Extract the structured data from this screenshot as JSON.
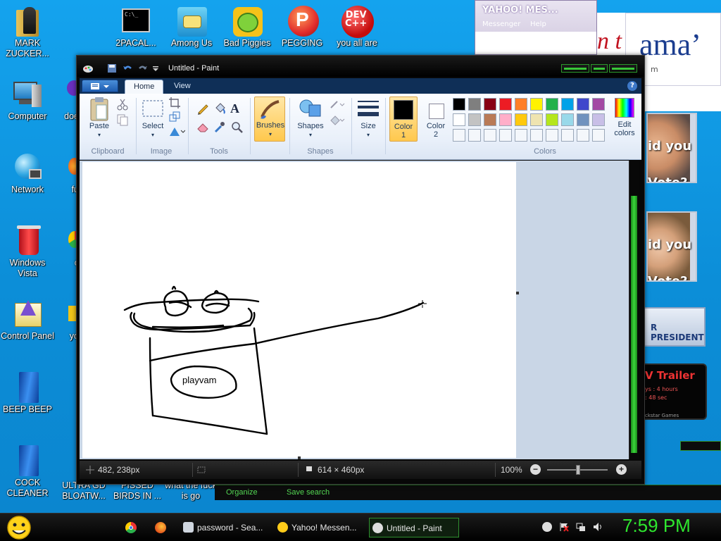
{
  "desktop": {
    "icons_col1": [
      {
        "label": "MARK ZUCKER..."
      },
      {
        "label": "Computer"
      },
      {
        "label": "Network"
      },
      {
        "label": "Windows Vista"
      },
      {
        "label": "Control Panel"
      },
      {
        "label": "BEEP BEEP"
      },
      {
        "label": "COCK CLEANER"
      }
    ],
    "icons_col2": [
      {
        "label": "doe"
      },
      {
        "label": "fu"
      },
      {
        "label": "c"
      },
      {
        "label": "yo"
      }
    ],
    "icons_top": [
      {
        "label": "2PACAL..."
      },
      {
        "label": "Among Us"
      },
      {
        "label": "Bad Piggies"
      },
      {
        "label": "PEGGING"
      },
      {
        "label": "you all are"
      }
    ],
    "icons_bottom": [
      {
        "label": "ULTRA GD BLOATW..."
      },
      {
        "label": "PISSED BIRDS IN ..."
      },
      {
        "label": "what the fuck is go"
      }
    ],
    "yahoo_window": {
      "title": "YAHOO! MES...",
      "menu": [
        "Messenger",
        "Help"
      ]
    },
    "bg_page": {
      "banner_text": "n t",
      "logo_text": "ama’",
      "logo_sub": "m",
      "ad1": "id you\nVote?",
      "ad2": "id you\nVote?",
      "president_btn": "R PRESIDENT",
      "trailer": {
        "title": "V Trailer",
        "l1": "ys : 4 hours",
        "l2": ": 48 sec",
        "brand": "ckstar Games"
      }
    }
  },
  "paint": {
    "title": "Untitled - Paint",
    "tabs": [
      "Home",
      "View"
    ],
    "active_tab": "Home",
    "groups": {
      "clipboard": {
        "name": "Clipboard",
        "paste": "Paste"
      },
      "image": {
        "name": "Image",
        "select": "Select"
      },
      "tools": {
        "name": "Tools"
      },
      "brushes": {
        "label": "Brushes"
      },
      "shapes": {
        "name": "Shapes",
        "label": "Shapes"
      },
      "size": {
        "label": "Size"
      },
      "color1": {
        "label": "Color\n1"
      },
      "color2": {
        "label": "Color\n2"
      },
      "colors": {
        "name": "Colors",
        "edit": "Edit\ncolors"
      }
    },
    "palette_row1": [
      "#000000",
      "#7f7f7f",
      "#880015",
      "#ed1c24",
      "#ff7f27",
      "#fff200",
      "#22b14c",
      "#00a2e8",
      "#3f48cc",
      "#a349a4"
    ],
    "palette_row2": [
      "#ffffff",
      "#c3c3c3",
      "#b97a57",
      "#ffaec9",
      "#ffc90e",
      "#efe4b0",
      "#b5e61d",
      "#99d9ea",
      "#7092be",
      "#c8bfe7"
    ],
    "color1_value": "#000000",
    "color2_value": "#ffffff",
    "canvas_text": "playvam",
    "status": {
      "cursor_pos": "482, 238px",
      "canvas_size": "614 × 460px",
      "zoom": "100%"
    }
  },
  "folderbar": {
    "organize": "Organize",
    "save_search": "Save search"
  },
  "taskbar": {
    "buttons": [
      {
        "label": "password - Sea..."
      },
      {
        "label": "Yahoo! Messen..."
      },
      {
        "label": "Untitled - Paint"
      }
    ],
    "clock": "7:59 PM"
  }
}
